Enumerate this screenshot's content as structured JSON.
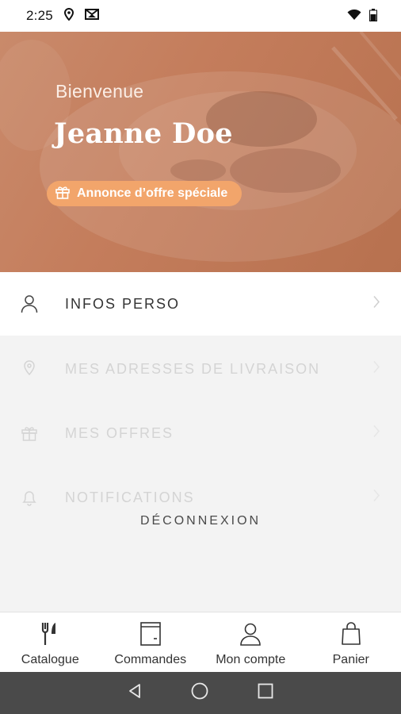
{
  "status": {
    "time": "2:25"
  },
  "hero": {
    "greeting": "Bienvenue",
    "name": "Jeanne Doe",
    "offer_label": "Annonce d’offre spéciale"
  },
  "menu": {
    "items": [
      {
        "label": "INFOS PERSO",
        "icon": "person-icon",
        "enabled": true
      },
      {
        "label": "MES ADRESSES DE LIVRAISON",
        "icon": "location-pin-icon",
        "enabled": false
      },
      {
        "label": "MES OFFRES",
        "icon": "gift-icon",
        "enabled": false
      },
      {
        "label": "NOTIFICATIONS",
        "icon": "bell-icon",
        "enabled": false
      }
    ],
    "logout_label": "DÉCONNEXION"
  },
  "bottom_nav": {
    "items": [
      {
        "label": "Catalogue",
        "icon": "fork-knife-icon"
      },
      {
        "label": "Commandes",
        "icon": "orders-icon"
      },
      {
        "label": "Mon compte",
        "icon": "account-icon"
      },
      {
        "label": "Panier",
        "icon": "bag-icon"
      }
    ]
  },
  "colors": {
    "accent": "#f2a56b",
    "hero": "#c47d5c"
  }
}
